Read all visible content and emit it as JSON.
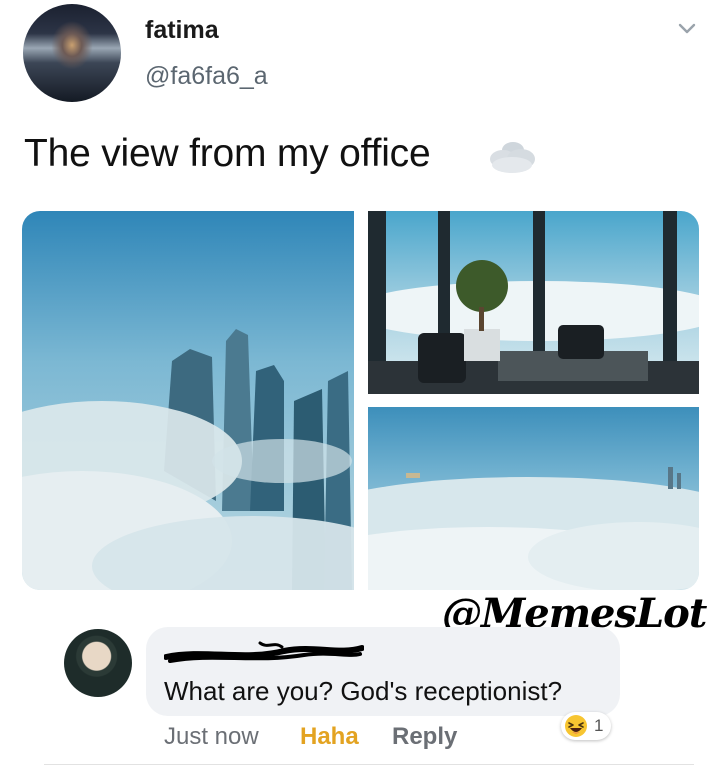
{
  "tweet": {
    "author_name": "fatima",
    "author_handle": "@fa6fa6_a",
    "text": "The view from my office",
    "icons": {
      "menu": "chevron-down-icon",
      "emoji": "cloud-icon"
    }
  },
  "watermark": "@MemesLot",
  "comment": {
    "text": "What are you? God's receptionist?",
    "time": "Just now",
    "haha_label": "Haha",
    "reply_label": "Reply",
    "reaction": {
      "icon": "laughing-face-icon",
      "count": "1"
    }
  },
  "colors": {
    "haha": "#e3a321",
    "bubble": "#f0f2f5",
    "handle": "#5b6670",
    "sky": "#4f9fc4"
  }
}
